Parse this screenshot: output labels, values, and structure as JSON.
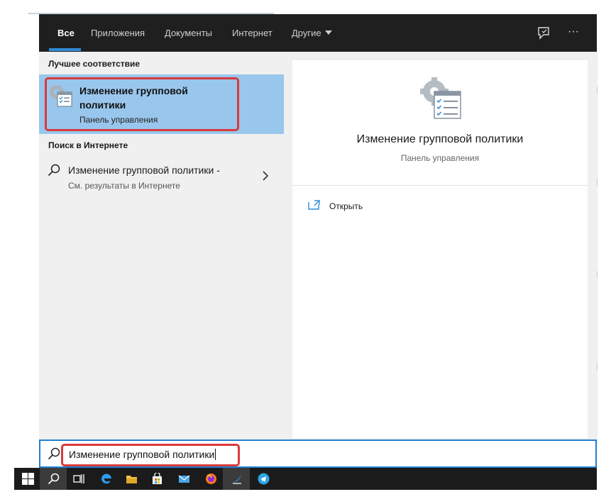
{
  "tabs": [
    {
      "label": "Все",
      "active": true
    },
    {
      "label": "Приложения"
    },
    {
      "label": "Документы"
    },
    {
      "label": "Интернет"
    },
    {
      "label": "Другие"
    }
  ],
  "top_icons": [
    "feedback-icon",
    "more-options-icon"
  ],
  "more_label": "···",
  "best_match": {
    "section_title": "Лучшее соответствие",
    "title": "Изменение групповой политики",
    "subtitle": "Панель управления"
  },
  "web": {
    "section_title": "Поиск в Интернете",
    "title": "Изменение групповой политики -",
    "subtitle": "См. результаты в Интернете"
  },
  "detail": {
    "title": "Изменение групповой политики",
    "subtitle": "Панель управления",
    "actions": [
      {
        "label": "Открыть",
        "icon": "open-icon"
      }
    ]
  },
  "search": {
    "value": "Изменение групповой политики"
  },
  "taskbar": [
    "windows-start-icon",
    "search-icon",
    "task-view-icon",
    "edge-icon",
    "file-explorer-icon",
    "store-icon",
    "mail-icon",
    "firefox-icon",
    "app-icon",
    "telegram-icon"
  ],
  "colors": {
    "accent": "#2f8bd6",
    "selection": "#99c6ec",
    "highlight_box": "#d93a3a",
    "topbar": "#1f1f1f",
    "taskbar": "#1b1b1b"
  }
}
